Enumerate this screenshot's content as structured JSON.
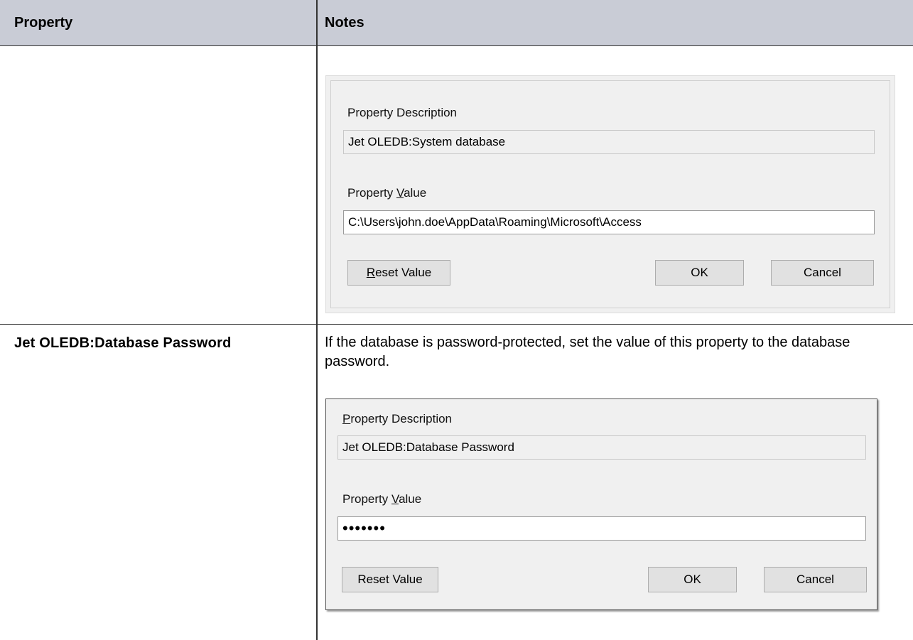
{
  "table": {
    "headers": {
      "property": "Property",
      "notes": "Notes"
    },
    "rows": [
      {
        "property": "",
        "dialog": {
          "description_label": {
            "first": "Property Description",
            "underline": ""
          },
          "description_value": "Jet OLEDB:System database",
          "value_label": {
            "pre": "Property ",
            "underline": "V",
            "post": "alue"
          },
          "value": "C:\\Users\\john.doe\\AppData\\Roaming\\Microsoft\\Access",
          "reset": {
            "underline": "R",
            "post": "eset Value"
          },
          "ok": "OK",
          "cancel": "Cancel"
        }
      },
      {
        "property": "Jet OLEDB:Database Password",
        "note": "If the database is password-protected, set the value of this property to the database password.",
        "dialog": {
          "description_label": {
            "underline": "P",
            "post": "roperty Description"
          },
          "description_value": "Jet OLEDB:Database Password",
          "value_label": {
            "pre": "Property ",
            "underline": "V",
            "post": "alue"
          },
          "value": "•••••••",
          "reset": "Reset Value",
          "ok": "OK",
          "cancel": "Cancel"
        }
      }
    ]
  }
}
